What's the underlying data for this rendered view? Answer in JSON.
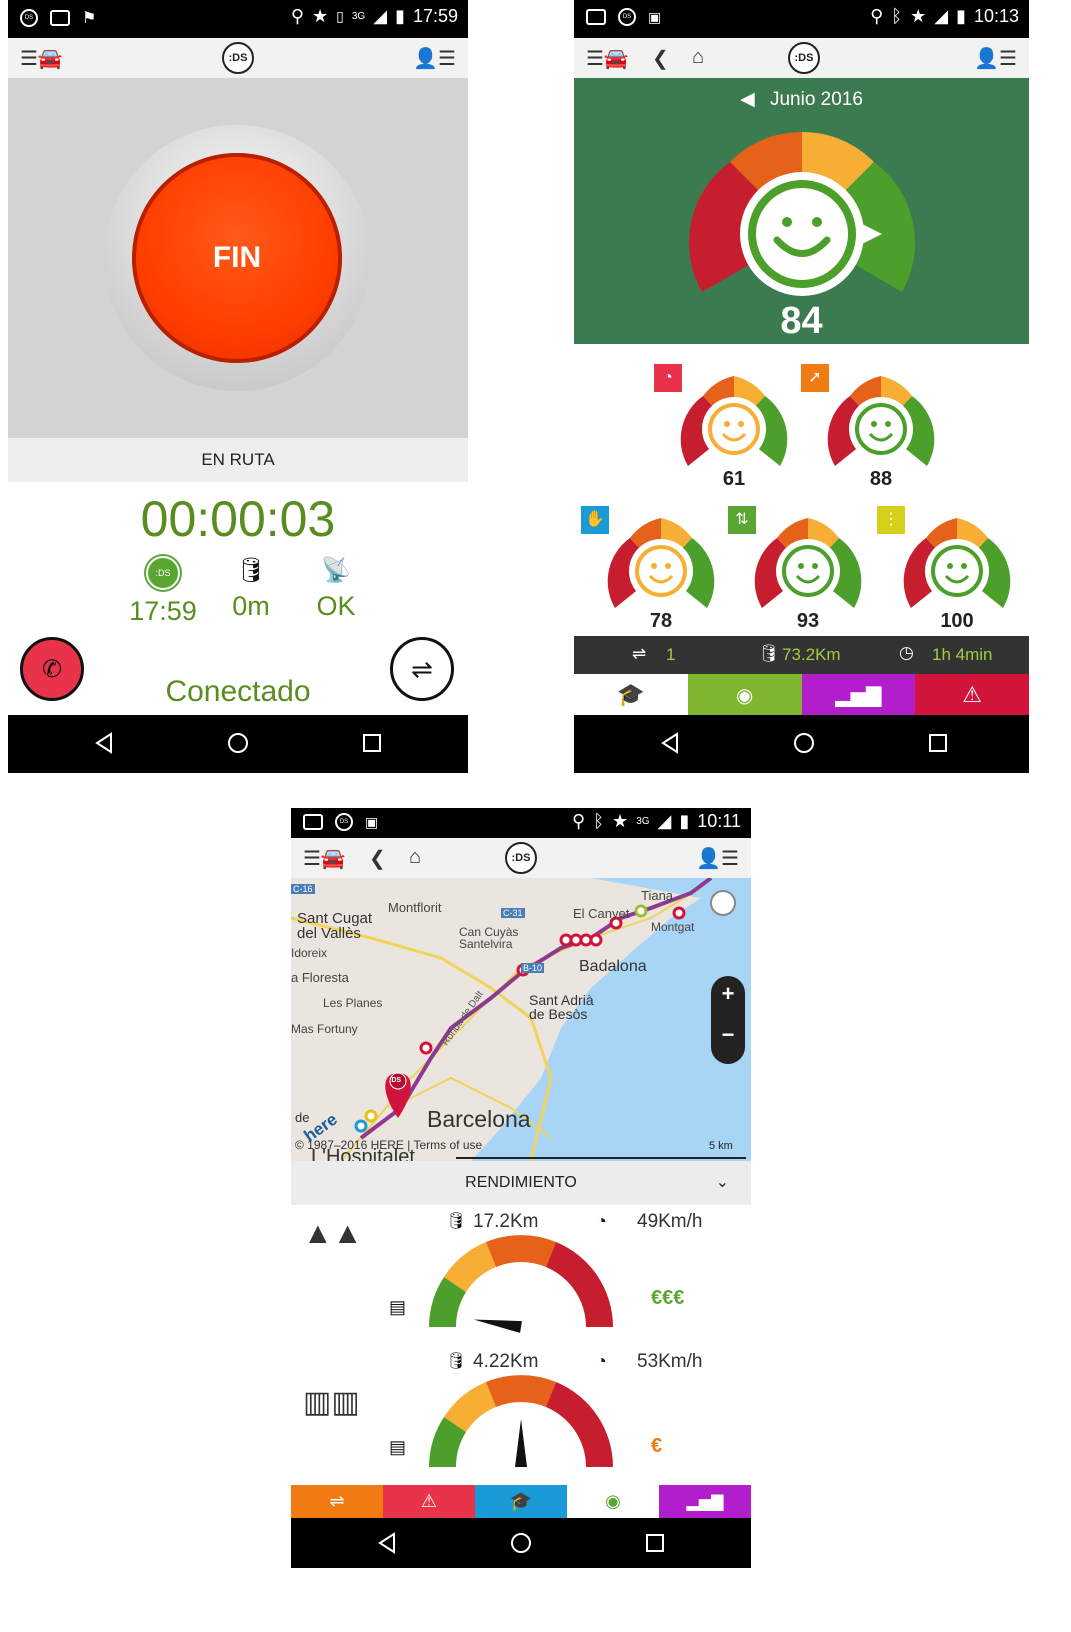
{
  "phone1": {
    "status_time": "17:59",
    "status_net": "3G",
    "logo": ":DS",
    "fin_label": "FIN",
    "state_label": "EN RUTA",
    "timer": "00:00:03",
    "info": [
      {
        "icon": "ds-icon",
        "value": "17:59"
      },
      {
        "icon": "odometer-icon",
        "value": "0m"
      },
      {
        "icon": "satellite-icon",
        "value": "OK"
      }
    ],
    "connection": "Conectado",
    "colors": {
      "fin": "#ff4000",
      "timer": "#5a8c1f",
      "call": "#e8334a"
    }
  },
  "phone2": {
    "status_time": "10:13",
    "logo": ":DS",
    "month": "Junio 2016",
    "score": "84",
    "sub_scores": [
      {
        "icon": "speedometer-icon",
        "value": "61",
        "color": "#e8334a"
      },
      {
        "icon": "acceleration-icon",
        "value": "88",
        "color": "#f07b13"
      },
      {
        "icon": "stop-hand-icon",
        "value": "78",
        "color": "#1a9ad6"
      },
      {
        "icon": "overtake-icon",
        "value": "93",
        "color": "#5aa632"
      },
      {
        "icon": "traffic-light-icon",
        "value": "100",
        "color": "#d6cf1a"
      }
    ],
    "summary": {
      "trips": "1",
      "distance": "73.2Km",
      "duration": "1h 4min"
    },
    "tabs": [
      {
        "icon": "graduation-cap-icon",
        "color": "#ffffff"
      },
      {
        "icon": "eco-gauge-icon",
        "color": "#7fb52f"
      },
      {
        "icon": "bar-chart-icon",
        "color": "#b21ecb"
      },
      {
        "icon": "warning-icon",
        "color": "#d2143a"
      }
    ],
    "colors": {
      "header": "#3b7b4f"
    }
  },
  "phone3": {
    "status_time": "10:11",
    "status_net": "3G",
    "logo": ":DS",
    "map": {
      "places": [
        "Montflorit",
        "Tiana",
        "Sant Cugat del Vallès",
        "El Canyet",
        "Montgat",
        "Can Cuyàs Santelvira",
        "Badalona",
        "Idoreix",
        "a Floresta",
        "Les Planes",
        "Sant Adrià de Besòs",
        "Mas Fortuny",
        "Barcelona",
        "L'Hospitalet",
        "Ronda de Dalt",
        "C-31",
        "C-16",
        "B-10",
        "de"
      ],
      "copyright": "© 1987–2016 HERE | Terms of use",
      "scale": "5 km",
      "brand": "here",
      "pin_label": ":DS",
      "zoom_in": "+",
      "zoom_out": "−"
    },
    "section_title": "RENDIMIENTO",
    "rows": [
      {
        "icon": "mountain-icon",
        "distance": "17.2Km",
        "speed": "49Km/h",
        "cost": "€€€",
        "cost_color": "#5aa632",
        "needle_pct": 0.05
      },
      {
        "icon": "city-icon",
        "distance": "4.22Km",
        "speed": "53Km/h",
        "cost": "€",
        "cost_color": "#f07b13",
        "needle_pct": 0.5
      }
    ],
    "tabs": [
      {
        "icon": "signpost-icon",
        "color": "#f07b13"
      },
      {
        "icon": "warning-icon",
        "color": "#e8334a"
      },
      {
        "icon": "graduation-cap-icon",
        "color": "#1a9ad6"
      },
      {
        "icon": "eco-gauge-icon",
        "color": "#ffffff"
      },
      {
        "icon": "bar-chart-icon",
        "color": "#b21ecb"
      }
    ]
  }
}
